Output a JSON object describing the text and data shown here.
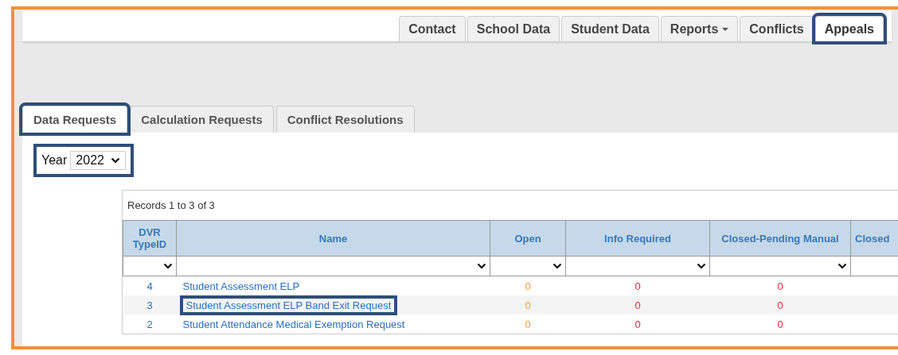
{
  "top_tabs": [
    {
      "label": "Contact",
      "selected": false,
      "highlighted": false
    },
    {
      "label": "School Data",
      "selected": false,
      "highlighted": false
    },
    {
      "label": "Student Data",
      "selected": false,
      "highlighted": false
    },
    {
      "label": "Reports",
      "selected": false,
      "highlighted": false,
      "dropdown": true
    },
    {
      "label": "Conflicts",
      "selected": false,
      "highlighted": false
    },
    {
      "label": "Appeals",
      "selected": true,
      "highlighted": true
    }
  ],
  "sub_tabs": [
    {
      "label": "Data Requests",
      "selected": true,
      "highlighted": true
    },
    {
      "label": "Calculation Requests",
      "selected": false,
      "highlighted": false
    },
    {
      "label": "Conflict Resolutions",
      "selected": false,
      "highlighted": false
    }
  ],
  "year": {
    "label": "Year",
    "value": "2022",
    "highlighted": true
  },
  "table": {
    "records": "Records 1 to 3 of 3",
    "columns": [
      {
        "label": "DVR TypeID",
        "kind": "id"
      },
      {
        "label": "Name",
        "kind": "name"
      },
      {
        "label": "Open",
        "kind": "count",
        "color": "#f0a030"
      },
      {
        "label": "Info Required",
        "kind": "count",
        "color": "#e0283c"
      },
      {
        "label": "Closed-Pending Manual",
        "kind": "count",
        "color": "#e0283c"
      },
      {
        "label": "Closed",
        "kind": "partial"
      }
    ],
    "rows": [
      {
        "cells": [
          "4",
          "Student Assessment ELP",
          "0",
          "0",
          "0"
        ],
        "highlighted": false
      },
      {
        "cells": [
          "3",
          "Student Assessment ELP Band Exit Request",
          "0",
          "0",
          "0"
        ],
        "highlighted": true
      },
      {
        "cells": [
          "2",
          "Student Attendance Medical Exemption Request",
          "0",
          "0",
          "0"
        ],
        "highlighted": false
      }
    ]
  }
}
